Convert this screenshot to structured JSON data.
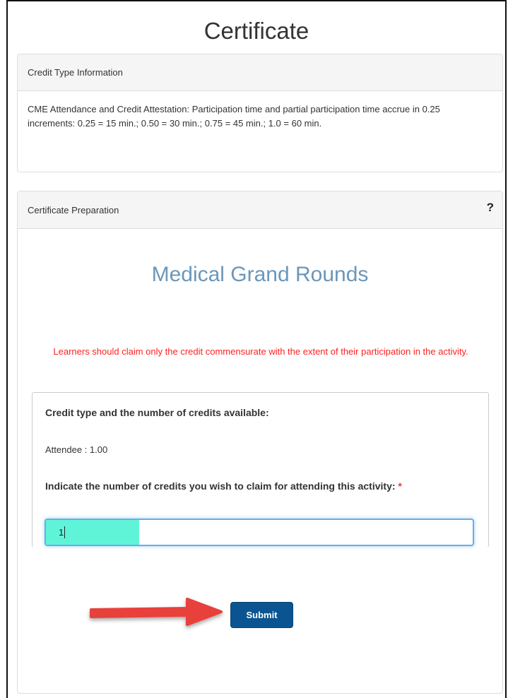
{
  "page": {
    "title": "Certificate"
  },
  "credit_type_panel": {
    "heading": "Credit Type Information",
    "body": "CME Attendance and Credit Attestation: Participation time and partial participation time accrue in 0.25 increments: 0.25 = 15 min.; 0.50 = 30 min.; 0.75 = 45 min.; 1.0 = 60 min."
  },
  "certificate_panel": {
    "heading": "Certificate Preparation",
    "help": "?",
    "activity_title": "Medical Grand Rounds",
    "warning": "Learners should claim only the credit commensurate with the extent of their participation in the activity.",
    "credit_available_label": "Credit type and the number of credits available:",
    "attendee_line": "Attendee : 1.00",
    "claim_label": "Indicate the number of credits you wish to claim for attending this activity:",
    "required_mark": "*",
    "claim_value": "1",
    "submit_label": "Submit"
  },
  "colors": {
    "accent_blue": "#0a5591",
    "title_blue": "#6b97b9",
    "warning_red": "#ff1f1f",
    "highlight": "#5ff4d8",
    "arrow_red": "#e8413a"
  },
  "icons": {
    "help": "question-mark-icon",
    "annotation": "red-arrow-icon"
  }
}
